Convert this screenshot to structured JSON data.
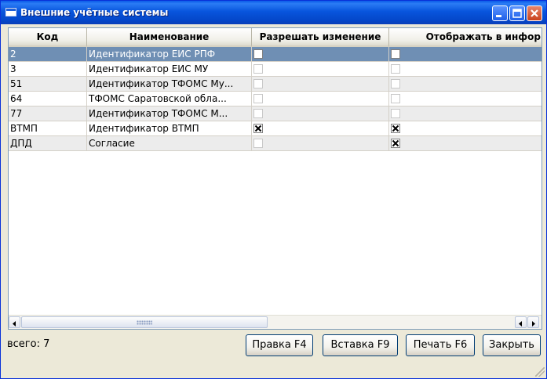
{
  "window": {
    "title": "Внешние учётные системы",
    "controls": [
      "minimize-icon",
      "maximize-icon",
      "close-icon"
    ]
  },
  "table": {
    "columns": [
      "Код",
      "Наименование",
      "Разрешать изменение",
      "Отображать в инфор"
    ],
    "rows": [
      {
        "code": "2",
        "name": "Идентификатор ЕИС РПФ",
        "allow_edit": false,
        "show": false,
        "selected": true
      },
      {
        "code": "3",
        "name": "Идентификатор ЕИС МУ",
        "allow_edit": false,
        "show": false
      },
      {
        "code": "51",
        "name": "Идентификатор ТФОМС Му...",
        "allow_edit": false,
        "show": false
      },
      {
        "code": "64",
        "name": "ТФОМС Саратовской обла...",
        "allow_edit": false,
        "show": false
      },
      {
        "code": "77",
        "name": "Идентификатор ТФОМС М...",
        "allow_edit": false,
        "show": false
      },
      {
        "code": "ВТМП",
        "name": "Идентификатор ВТМП",
        "allow_edit": true,
        "show": true
      },
      {
        "code": "ДПД",
        "name": "Согласие",
        "allow_edit": false,
        "show": true
      }
    ]
  },
  "status": {
    "total_label": "всего: 7"
  },
  "buttons": {
    "edit": "Правка F4",
    "insert": "Вставка F9",
    "print": "Печать F6",
    "close": "Закрыть"
  }
}
